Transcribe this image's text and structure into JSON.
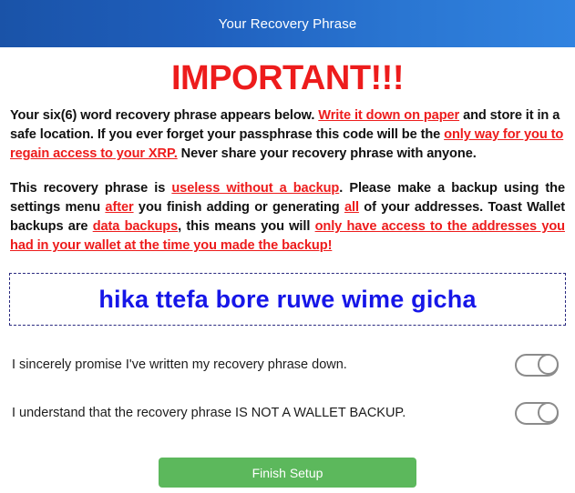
{
  "window": {
    "title": "Your Recovery Phrase",
    "header_gradient_from": "#1a53a8",
    "header_gradient_to": "#3183e0"
  },
  "colors": {
    "warning_red": "#ed1c1c",
    "phrase_blue": "#1616e8",
    "phrase_border": "#2b2b80",
    "button_green": "#5cb85c",
    "toggle_border": "#8b8b8b"
  },
  "main": {
    "important_heading": "IMPORTANT!!!",
    "paragraph1": {
      "seg1": "Your six(6) word recovery phrase appears below. ",
      "seg2_red_underline": "Write it down on paper",
      "seg3": " and store it in a safe location. If you ever forget your passphrase this code will be the ",
      "seg4_red_underline": "only way for you to regain access to your XRP.",
      "seg5": "  Never share your recovery phrase with anyone."
    },
    "paragraph2": {
      "seg1": "This recovery phrase is ",
      "seg2_red_underline": "useless without a backup",
      "seg3": ". Please make a backup using the settings menu ",
      "seg4_red_underline": "after",
      "seg5": " you finish adding or generating ",
      "seg6_red_underline": "all",
      "seg7": " of your addresses. Toast Wallet backups are ",
      "seg8_red_underline": "data backups",
      "seg9": ", this means you will ",
      "seg10_red_underline": "only have access to the addresses you had in your wallet at the time you made the backup!"
    },
    "recovery_phrase": "hika ttefa bore ruwe wime gicha",
    "confirmations": [
      {
        "label": "I sincerely promise I've written my recovery phrase down.",
        "toggle_state": "off"
      },
      {
        "label": "I understand that the recovery phrase IS NOT A WALLET BACKUP.",
        "toggle_state": "off"
      }
    ],
    "finish_button_label": "Finish Setup"
  }
}
